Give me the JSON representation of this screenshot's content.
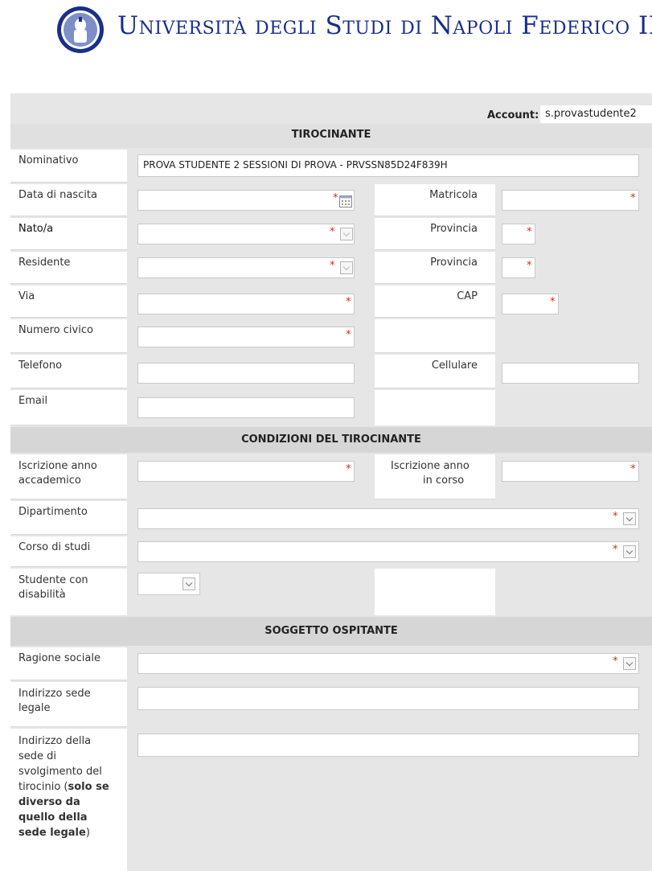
{
  "header": {
    "university_name": "Università degli Studi di Napoli Federico II"
  },
  "account": {
    "label": "Account:",
    "value": "s.provastudente2"
  },
  "sections": {
    "tirocinante": "TIROCINANTE",
    "condizioni": "CONDIZIONI DEL TIROCINANTE",
    "soggetto": "SOGGETTO OSPITANTE"
  },
  "tirocinante": {
    "nominativo_label": "Nominativo",
    "nominativo_value": "PROVA STUDENTE 2 SESSIONI DI PROVA - PRVSSN85D24F839H",
    "data_nascita_label": "Data di nascita",
    "matricola_label": "Matricola",
    "nato_label": "Nato/a",
    "provincia_label": "Provincia",
    "residente_label": "Residente",
    "via_label": "Via",
    "cap_label": "CAP",
    "numero_civico_label": "Numero civico",
    "telefono_label": "Telefono",
    "cellulare_label": "Cellulare",
    "email_label": "Email"
  },
  "condizioni": {
    "iscrizione_accademico_label_1": "Iscrizione anno",
    "iscrizione_accademico_label_2": "accademico",
    "iscrizione_corso_label_1": "Iscrizione anno",
    "iscrizione_corso_label_2": "in corso",
    "dipartimento_label": "Dipartimento",
    "corso_label": "Corso di studi",
    "disabilita_label_1": "Studente con",
    "disabilita_label_2": "disabilità"
  },
  "soggetto": {
    "ragione_sociale_label": "Ragione sociale",
    "indirizzo_legale_label_1": "Indirizzo sede",
    "indirizzo_legale_label_2": "legale",
    "svolgimento_l1": "Indirizzo della",
    "svolgimento_l2": "sede di",
    "svolgimento_l3": "svolgimento del",
    "svolgimento_l4a": "tirocinio (",
    "svolgimento_l4b": "solo se",
    "svolgimento_l5": "diverso da",
    "svolgimento_l6": "quello della",
    "svolgimento_l7a": "sede legale",
    "svolgimento_l7b": ")"
  },
  "required_mark": "*",
  "colors": {
    "brand_blue": "#1a2f8a",
    "required_red": "#e0261b",
    "section_gray": "#d6d6d6",
    "panel_gray": "#e6e6e6"
  },
  "icons": [
    "university-seal-icon",
    "calendar-icon",
    "chevron-down-icon"
  ]
}
